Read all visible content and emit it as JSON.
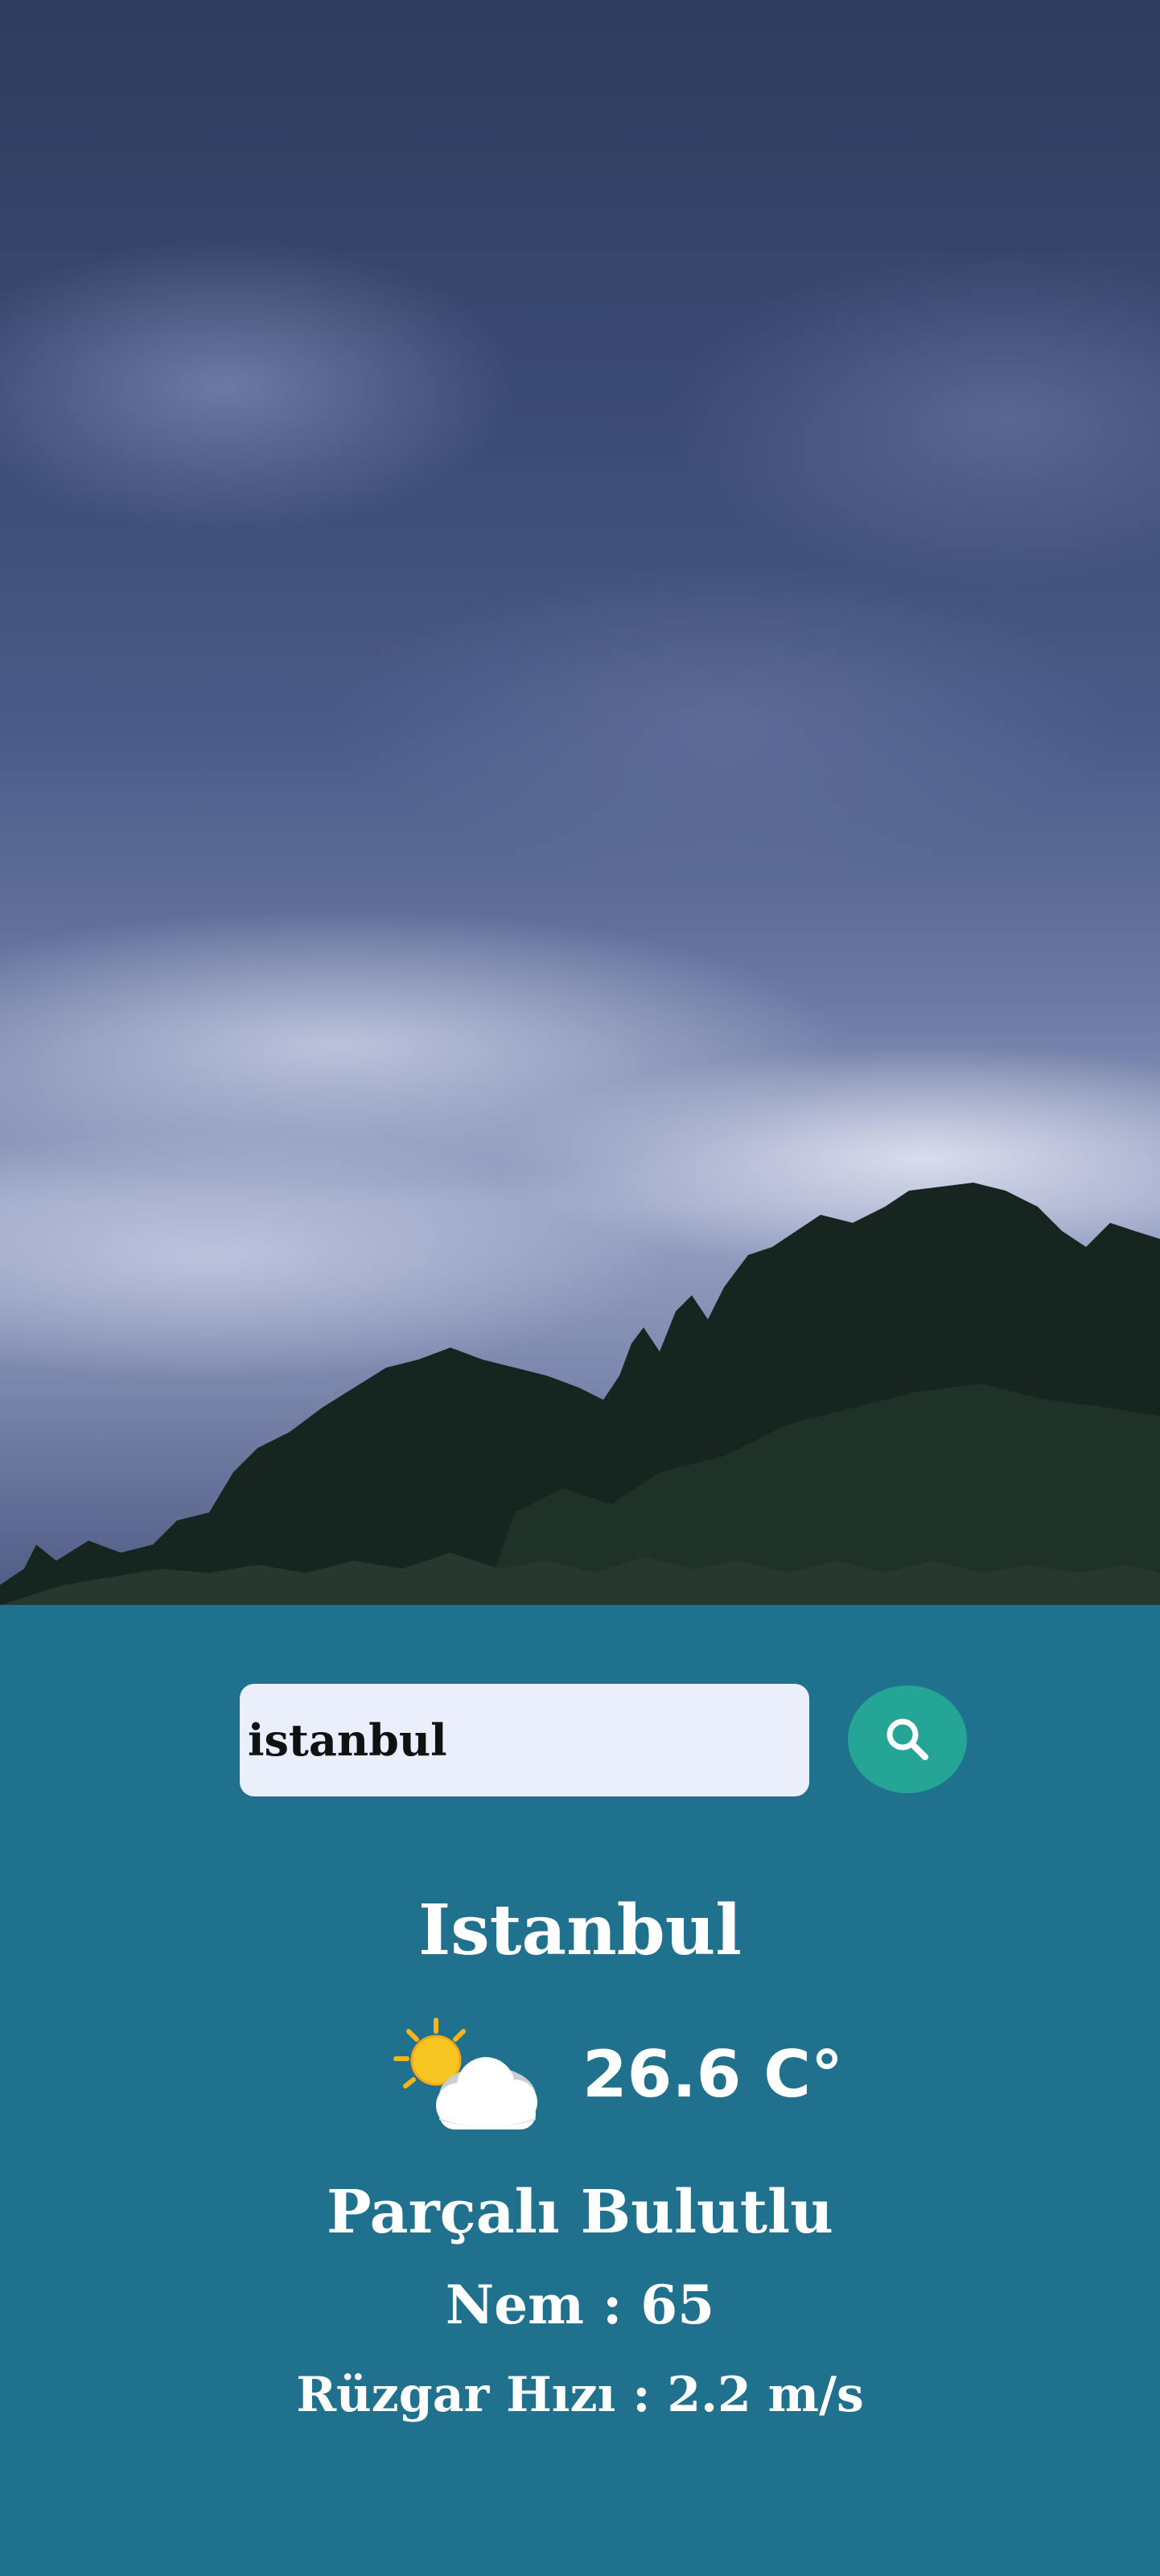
{
  "background": {
    "description_icon": "stormy-sky-photo"
  },
  "search": {
    "value": "istanbul",
    "icon": "search-icon"
  },
  "weather": {
    "city": "Istanbul",
    "icon": "partly-cloudy-icon",
    "temperature": "26.6 C°",
    "description": "Parçalı Bulutlu",
    "humidity": "Nem : 65",
    "wind": "Rüzgar Hızı : 2.2 m/s"
  },
  "colors": {
    "panel": "#20718e",
    "search_button": "#25a596",
    "input_bg": "#eaeffb",
    "text": "#ffffff"
  }
}
